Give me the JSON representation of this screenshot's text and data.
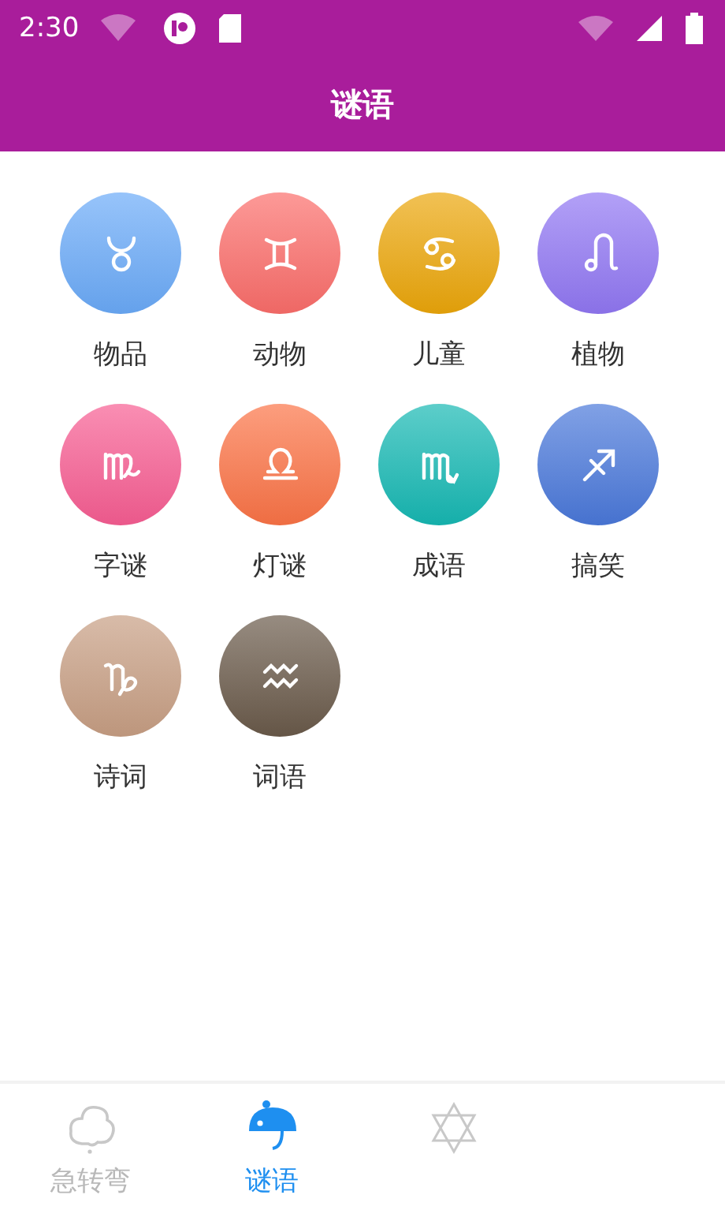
{
  "status_bar": {
    "time": "2:30"
  },
  "header": {
    "title": "谜语"
  },
  "categories": [
    {
      "label": "物品",
      "color": "#6aaaf8"
    },
    {
      "label": "动物",
      "color": "#fb6d6a"
    },
    {
      "label": "儿童",
      "color": "#eba60a"
    },
    {
      "label": "植物",
      "color": "#9177f3"
    },
    {
      "label": "字谜",
      "color": "#f75d92"
    },
    {
      "label": "灯谜",
      "color": "#fb7346"
    },
    {
      "label": "成语",
      "color": "#16b8b3"
    },
    {
      "label": "搞笑",
      "color": "#4a78da"
    },
    {
      "label": "诗词",
      "color": "#c79e83"
    },
    {
      "label": "词语",
      "color": "#6a5a4a"
    }
  ],
  "tabs": [
    {
      "label": "急转弯",
      "selected": false
    },
    {
      "label": "谜语",
      "selected": true
    },
    {
      "selected": false
    }
  ]
}
